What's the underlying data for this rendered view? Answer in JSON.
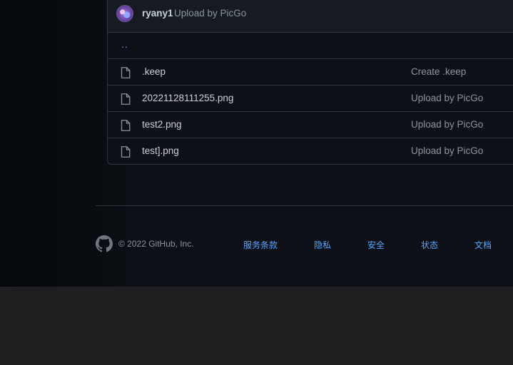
{
  "commit_bar": {
    "author": "ryany1",
    "message": "Upload by PicGo"
  },
  "parent_link": "..",
  "files": [
    {
      "name": ".keep",
      "commit": "Create .keep"
    },
    {
      "name": "20221128111255.png",
      "commit": "Upload by PicGo"
    },
    {
      "name": "test2.png",
      "commit": "Upload by PicGo"
    },
    {
      "name": "test].png",
      "commit": "Upload by PicGo"
    }
  ],
  "footer": {
    "copyright": "© 2022 GitHub, Inc.",
    "links": [
      "服务条款",
      "隐私",
      "安全",
      "状态",
      "文档"
    ]
  },
  "colors": {
    "page_bg": "#0d1117",
    "link": "#58a6ff",
    "text": "#c9d1d9",
    "muted": "#8b949e",
    "border": "#30363d"
  }
}
